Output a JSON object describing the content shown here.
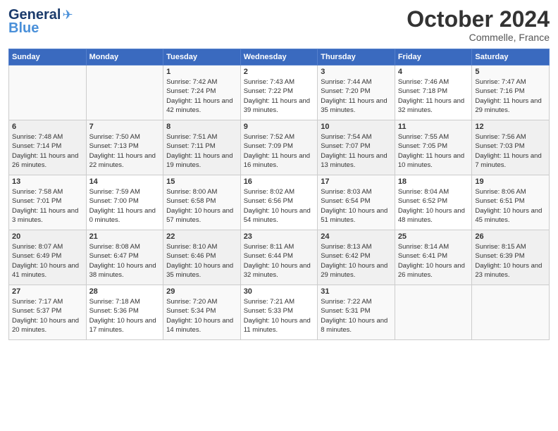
{
  "header": {
    "logo_line1": "General",
    "logo_line2": "Blue",
    "month": "October 2024",
    "location": "Commelle, France"
  },
  "weekdays": [
    "Sunday",
    "Monday",
    "Tuesday",
    "Wednesday",
    "Thursday",
    "Friday",
    "Saturday"
  ],
  "weeks": [
    [
      {
        "day": "",
        "info": ""
      },
      {
        "day": "",
        "info": ""
      },
      {
        "day": "1",
        "info": "Sunrise: 7:42 AM\nSunset: 7:24 PM\nDaylight: 11 hours and 42 minutes."
      },
      {
        "day": "2",
        "info": "Sunrise: 7:43 AM\nSunset: 7:22 PM\nDaylight: 11 hours and 39 minutes."
      },
      {
        "day": "3",
        "info": "Sunrise: 7:44 AM\nSunset: 7:20 PM\nDaylight: 11 hours and 35 minutes."
      },
      {
        "day": "4",
        "info": "Sunrise: 7:46 AM\nSunset: 7:18 PM\nDaylight: 11 hours and 32 minutes."
      },
      {
        "day": "5",
        "info": "Sunrise: 7:47 AM\nSunset: 7:16 PM\nDaylight: 11 hours and 29 minutes."
      }
    ],
    [
      {
        "day": "6",
        "info": "Sunrise: 7:48 AM\nSunset: 7:14 PM\nDaylight: 11 hours and 26 minutes."
      },
      {
        "day": "7",
        "info": "Sunrise: 7:50 AM\nSunset: 7:13 PM\nDaylight: 11 hours and 22 minutes."
      },
      {
        "day": "8",
        "info": "Sunrise: 7:51 AM\nSunset: 7:11 PM\nDaylight: 11 hours and 19 minutes."
      },
      {
        "day": "9",
        "info": "Sunrise: 7:52 AM\nSunset: 7:09 PM\nDaylight: 11 hours and 16 minutes."
      },
      {
        "day": "10",
        "info": "Sunrise: 7:54 AM\nSunset: 7:07 PM\nDaylight: 11 hours and 13 minutes."
      },
      {
        "day": "11",
        "info": "Sunrise: 7:55 AM\nSunset: 7:05 PM\nDaylight: 11 hours and 10 minutes."
      },
      {
        "day": "12",
        "info": "Sunrise: 7:56 AM\nSunset: 7:03 PM\nDaylight: 11 hours and 7 minutes."
      }
    ],
    [
      {
        "day": "13",
        "info": "Sunrise: 7:58 AM\nSunset: 7:01 PM\nDaylight: 11 hours and 3 minutes."
      },
      {
        "day": "14",
        "info": "Sunrise: 7:59 AM\nSunset: 7:00 PM\nDaylight: 11 hours and 0 minutes."
      },
      {
        "day": "15",
        "info": "Sunrise: 8:00 AM\nSunset: 6:58 PM\nDaylight: 10 hours and 57 minutes."
      },
      {
        "day": "16",
        "info": "Sunrise: 8:02 AM\nSunset: 6:56 PM\nDaylight: 10 hours and 54 minutes."
      },
      {
        "day": "17",
        "info": "Sunrise: 8:03 AM\nSunset: 6:54 PM\nDaylight: 10 hours and 51 minutes."
      },
      {
        "day": "18",
        "info": "Sunrise: 8:04 AM\nSunset: 6:52 PM\nDaylight: 10 hours and 48 minutes."
      },
      {
        "day": "19",
        "info": "Sunrise: 8:06 AM\nSunset: 6:51 PM\nDaylight: 10 hours and 45 minutes."
      }
    ],
    [
      {
        "day": "20",
        "info": "Sunrise: 8:07 AM\nSunset: 6:49 PM\nDaylight: 10 hours and 41 minutes."
      },
      {
        "day": "21",
        "info": "Sunrise: 8:08 AM\nSunset: 6:47 PM\nDaylight: 10 hours and 38 minutes."
      },
      {
        "day": "22",
        "info": "Sunrise: 8:10 AM\nSunset: 6:46 PM\nDaylight: 10 hours and 35 minutes."
      },
      {
        "day": "23",
        "info": "Sunrise: 8:11 AM\nSunset: 6:44 PM\nDaylight: 10 hours and 32 minutes."
      },
      {
        "day": "24",
        "info": "Sunrise: 8:13 AM\nSunset: 6:42 PM\nDaylight: 10 hours and 29 minutes."
      },
      {
        "day": "25",
        "info": "Sunrise: 8:14 AM\nSunset: 6:41 PM\nDaylight: 10 hours and 26 minutes."
      },
      {
        "day": "26",
        "info": "Sunrise: 8:15 AM\nSunset: 6:39 PM\nDaylight: 10 hours and 23 minutes."
      }
    ],
    [
      {
        "day": "27",
        "info": "Sunrise: 7:17 AM\nSunset: 5:37 PM\nDaylight: 10 hours and 20 minutes."
      },
      {
        "day": "28",
        "info": "Sunrise: 7:18 AM\nSunset: 5:36 PM\nDaylight: 10 hours and 17 minutes."
      },
      {
        "day": "29",
        "info": "Sunrise: 7:20 AM\nSunset: 5:34 PM\nDaylight: 10 hours and 14 minutes."
      },
      {
        "day": "30",
        "info": "Sunrise: 7:21 AM\nSunset: 5:33 PM\nDaylight: 10 hours and 11 minutes."
      },
      {
        "day": "31",
        "info": "Sunrise: 7:22 AM\nSunset: 5:31 PM\nDaylight: 10 hours and 8 minutes."
      },
      {
        "day": "",
        "info": ""
      },
      {
        "day": "",
        "info": ""
      }
    ]
  ]
}
